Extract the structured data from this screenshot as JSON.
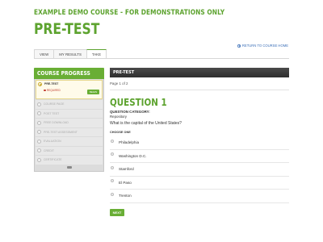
{
  "header": {
    "course_title": "EXAMPLE DEMO COURSE - FOR DEMONSTRATIONS ONLY",
    "page_title": "PRE-TEST",
    "return_link": "RETURN TO COURSE HOME"
  },
  "tabs": [
    {
      "label": "VIEW",
      "active": false
    },
    {
      "label": "MY RESULTS",
      "active": false
    },
    {
      "label": "TAKE",
      "active": true
    }
  ],
  "sidebar": {
    "title": "COURSE PROGRESS",
    "active_item": {
      "label": "PRE-TEST",
      "required_label": "REQUIRED",
      "begin_label": "BEGIN"
    },
    "items": [
      {
        "label": "COURSE PAGE"
      },
      {
        "label": "POST TEST"
      },
      {
        "label": "FREE DOWNLOAD"
      },
      {
        "label": "PRE-TEST ASSESSMENT"
      },
      {
        "label": "EVALUATION"
      },
      {
        "label": "CREDIT"
      },
      {
        "label": "CERTIFICATE"
      }
    ]
  },
  "main": {
    "header": "PRE-TEST",
    "page_of": "Page 1 of 2",
    "question_title": "QUESTION 1",
    "category_label": "QUESTION CATEGORY:",
    "category_value": "Repository",
    "question_text": "What is the capital of the United States?",
    "choose_label": "CHOOSE ONE",
    "answers": [
      {
        "label": "Philadelphia"
      },
      {
        "label": "Washington D.C."
      },
      {
        "label": "Stamford"
      },
      {
        "label": "El Paso"
      },
      {
        "label": "Trenton"
      }
    ],
    "next_label": "NEXT"
  },
  "colors": {
    "brand_green": "#5da32f",
    "header_dark": "#333333",
    "link_blue": "#3b6fb8",
    "required_red": "#c0392b"
  }
}
